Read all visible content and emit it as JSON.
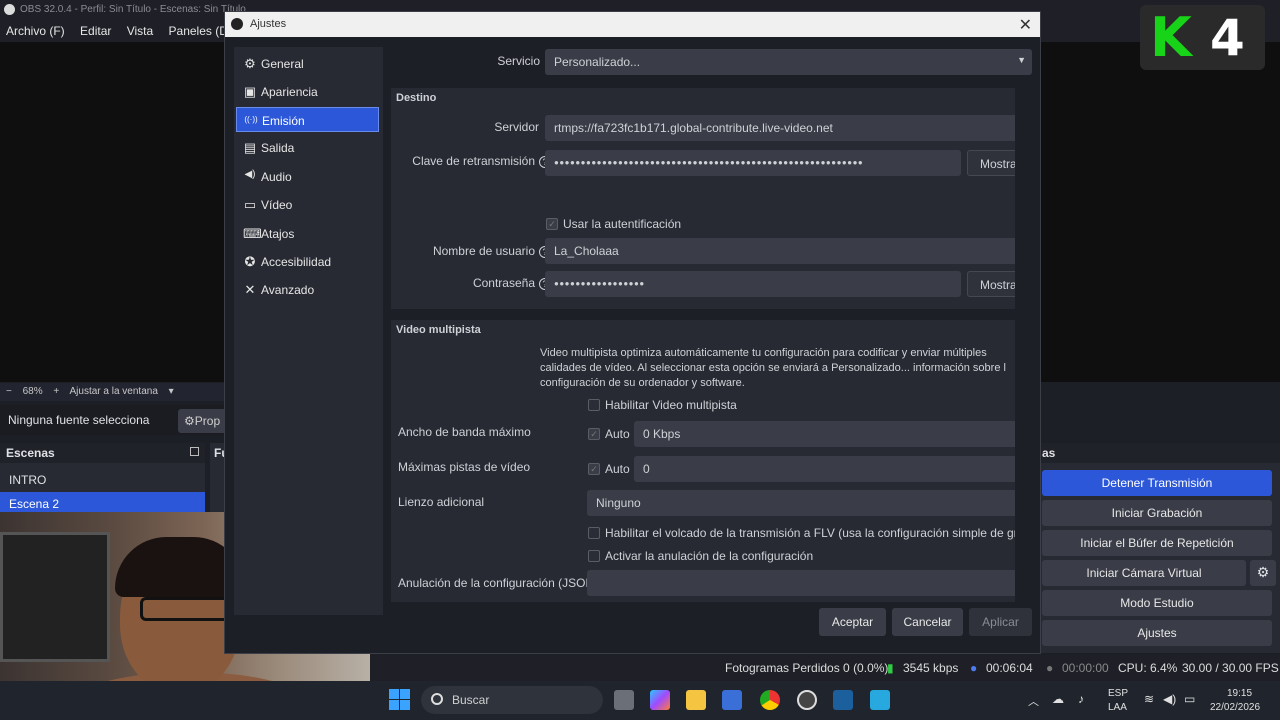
{
  "obs": {
    "title": "OBS 32.0.4 - Perfil: Sin Título - Escenas: Sin Título",
    "menu": [
      "Archivo (F)",
      "Editar",
      "Vista",
      "Paneles (D)"
    ],
    "zoom": "68%",
    "fit_label": "Ajustar a la ventana",
    "no_source": "Ninguna fuente selecciona",
    "properties_label": "Prop",
    "scenes_title": "Escenas",
    "scenes": [
      "INTRO",
      "Escena 2"
    ],
    "sources_title": "Fu",
    "controls_title": "as",
    "controls": {
      "stop_stream": "Detener Transmisión",
      "start_recording": "Iniciar Grabación",
      "start_replay": "Iniciar el Búfer de Repetición",
      "virtual_cam": "Iniciar Cámara Virtual",
      "studio_mode": "Modo Estudio",
      "settings": "Ajustes"
    },
    "status": {
      "dropped": "Fotogramas Perdidos 0 (0.0%)",
      "bitrate": "3545 kbps",
      "stream_time": "00:06:04",
      "rec_time": "00:00:00",
      "cpu": "CPU: 6.4%",
      "fps": "30.00 / 30.00 FPS"
    }
  },
  "logo": {
    "k": "K",
    "four": "4"
  },
  "dialog": {
    "title": "Ajustes",
    "nav": [
      {
        "icon": "gear-icon",
        "glyph": "⚙",
        "label": "General"
      },
      {
        "icon": "appearance-icon",
        "glyph": "▣",
        "label": "Apariencia"
      },
      {
        "icon": "broadcast-icon",
        "glyph": "((·))",
        "label": "Emisión"
      },
      {
        "icon": "output-icon",
        "glyph": "▤",
        "label": "Salida"
      },
      {
        "icon": "audio-icon",
        "glyph": "◀)",
        "label": "Audio"
      },
      {
        "icon": "video-icon",
        "glyph": "▭",
        "label": "Vídeo"
      },
      {
        "icon": "keyboard-icon",
        "glyph": "⌨",
        "label": "Atajos"
      },
      {
        "icon": "accessibility-icon",
        "glyph": "✪",
        "label": "Accesibilidad"
      },
      {
        "icon": "tools-icon",
        "glyph": "✕",
        "label": "Avanzado"
      }
    ],
    "service_label": "Servicio",
    "service_value": "Personalizado...",
    "destination_title": "Destino",
    "server_label": "Servidor",
    "server_value": "rtmps://fa723fc1b171.global-contribute.live-video.net",
    "stream_key_label": "Clave de retransmisión",
    "stream_key_value": "●●●●●●●●●●●●●●●●●●●●●●●●●●●●●●●●●●●●●●●●●●●●●●●●●●●●●●●●●●",
    "show_label": "Mostra",
    "use_auth_label": "Usar la autentificación",
    "username_label": "Nombre de usuario",
    "username_value": "La_Cholaaa",
    "password_label": "Contraseña",
    "password_value": "●●●●●●●●●●●●●●●●●",
    "multitrack_title": "Video multipista",
    "multitrack_desc": "Video multipista optimiza automáticamente tu configuración para codificar y enviar múltiples calidades de vídeo. Al seleccionar esta opción se enviará a Personalizado... información sobre l configuración de su ordenador y software.",
    "enable_multitrack": "Habilitar Video multipista",
    "max_bandwidth_label": "Ancho de banda máximo",
    "auto_label": "Auto",
    "max_bandwidth_value": "0 Kbps",
    "max_tracks_label": "Máximas pistas de vídeo",
    "max_tracks_value": "0",
    "extra_canvas_label": "Lienzo adicional",
    "extra_canvas_value": "Ninguno",
    "flv_dump_label": "Habilitar el volcado de la transmisión a FLV (usa la configuración simple de grabac",
    "override_label": "Activar la anulación de la configuración",
    "override_json_label": "Anulación de la configuración (JSON)",
    "ok": "Aceptar",
    "cancel": "Cancelar",
    "apply": "Aplicar"
  },
  "taskbar": {
    "search": "Buscar",
    "lang": "ESP",
    "lang2": "LAA",
    "time": "19:15",
    "date": "22/02/2026"
  },
  "colors": {
    "accent": "#2b57d8",
    "logo_green": "#18d418"
  }
}
